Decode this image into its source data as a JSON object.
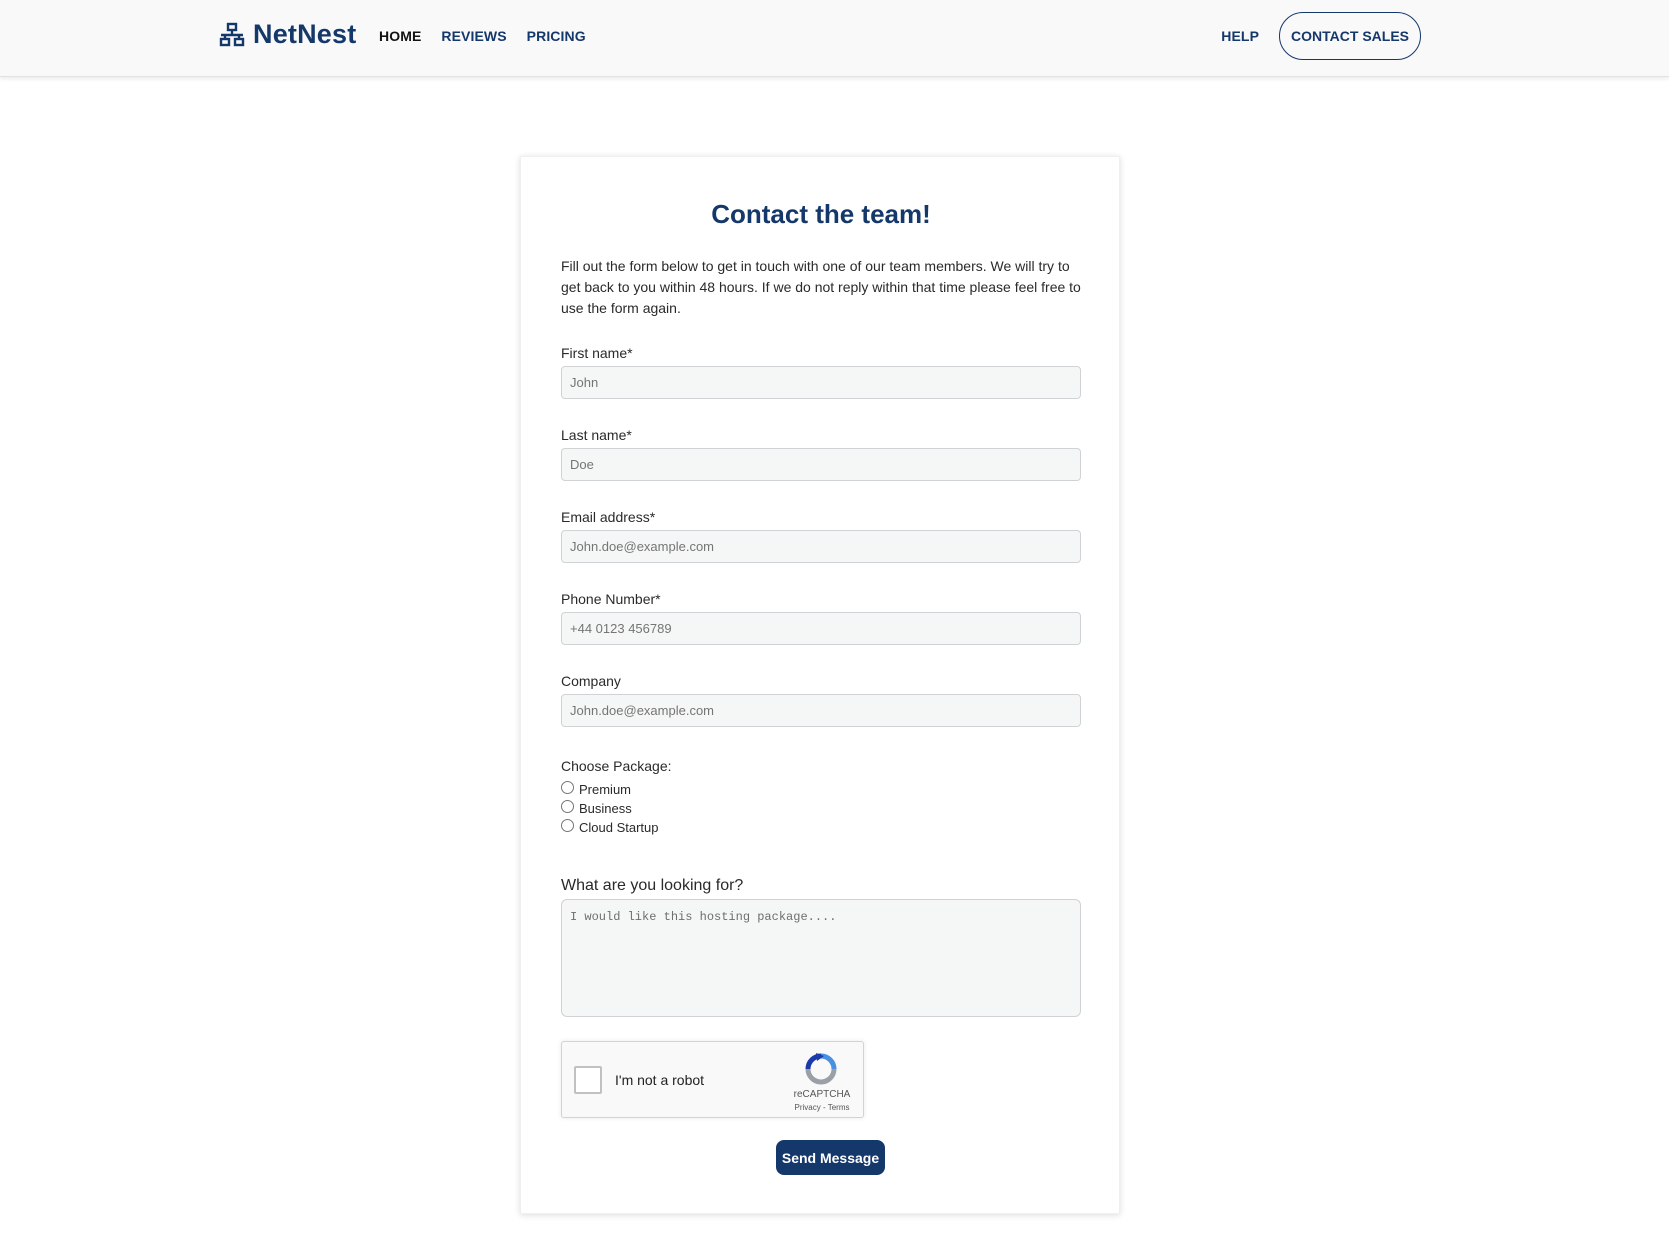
{
  "brand": {
    "name": "NetNest",
    "icon": "network-icon",
    "color": "#15386b"
  },
  "nav": {
    "left": [
      {
        "label": "HOME",
        "active": true
      },
      {
        "label": "REVIEWS",
        "active": false
      },
      {
        "label": "PRICING",
        "active": false
      }
    ],
    "help": "HELP",
    "contact_sales": "CONTACT SALES"
  },
  "form": {
    "title": "Contact the team!",
    "intro": "Fill out the form below to get in touch with one of our team members. We will try to get back to you within 48 hours. If we do not reply within that time please feel free to use the form again.",
    "fields": {
      "first_name": {
        "label": "First name*",
        "placeholder": "John",
        "value": ""
      },
      "last_name": {
        "label": "Last name*",
        "placeholder": "Doe",
        "value": ""
      },
      "email": {
        "label": "Email address*",
        "placeholder": "John.doe@example.com",
        "value": ""
      },
      "phone": {
        "label": "Phone Number*",
        "placeholder": "+44 0123 456789",
        "value": ""
      },
      "company": {
        "label": "Company",
        "placeholder": "John.doe@example.com",
        "value": ""
      }
    },
    "package": {
      "label": "Choose Package:",
      "options": [
        "Premium",
        "Business",
        "Cloud Startup"
      ],
      "selected": null
    },
    "looking_for": {
      "label": "What are you looking for?",
      "placeholder": "I would like this hosting package....",
      "value": ""
    },
    "recaptcha": {
      "label": "I'm not a robot",
      "brand": "reCAPTCHA",
      "privacy": "Privacy",
      "terms_sep": " - ",
      "terms": "Terms",
      "checked": false
    },
    "submit": "Send Message"
  }
}
